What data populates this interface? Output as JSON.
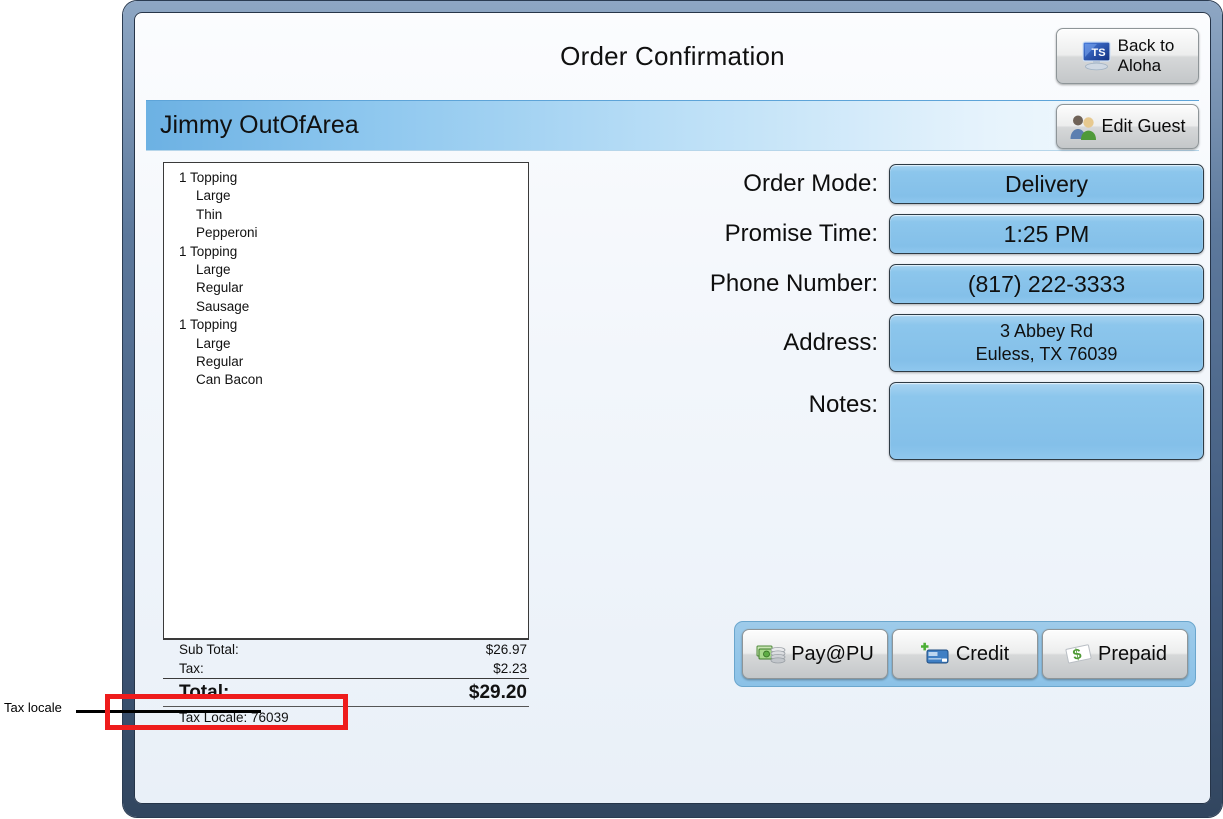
{
  "window": {
    "title": "Order Confirmation"
  },
  "header": {
    "back_button": {
      "label_line1": "Back to",
      "label_line2": "Aloha",
      "icon": "terminal-service-monitor-icon"
    },
    "edit_guest_button": {
      "label": "Edit Guest",
      "icon": "two-people-icon"
    }
  },
  "guest": {
    "name": "Jimmy OutOfArea"
  },
  "order": {
    "items": [
      {
        "name": "1 Topping",
        "modifiers": [
          "Large",
          "Thin",
          "Pepperoni"
        ]
      },
      {
        "name": "1 Topping",
        "modifiers": [
          "Large",
          "Regular",
          "Sausage"
        ]
      },
      {
        "name": "1 Topping",
        "modifiers": [
          "Large",
          "Regular",
          "Can Bacon"
        ]
      }
    ],
    "totals": {
      "subtotal_label": "Sub Total:",
      "subtotal_value": "$26.97",
      "tax_label": "Tax:",
      "tax_value": "$2.23",
      "total_label": "Total:",
      "total_value": "$29.20"
    },
    "tax_locale_text": "Tax Locale:  76039"
  },
  "fields": [
    {
      "label": "Order Mode:",
      "value": "Delivery"
    },
    {
      "label": "Promise Time:",
      "value": "1:25 PM"
    },
    {
      "label": "Phone Number:",
      "value": "(817) 222-3333"
    },
    {
      "label": "Address:",
      "value_line1": "3 Abbey Rd",
      "value_line2": "Euless, TX 76039"
    },
    {
      "label": "Notes:",
      "value": ""
    }
  ],
  "payment_buttons": [
    {
      "label": "Pay@PU",
      "icon": "cash-and-coins-icon"
    },
    {
      "label": "Credit",
      "icon": "credit-card-icon"
    },
    {
      "label": "Prepaid",
      "icon": "prepaid-check-icon"
    }
  ],
  "annotation": {
    "label": "Tax locale",
    "highlight_color": "#ee1c1c"
  }
}
